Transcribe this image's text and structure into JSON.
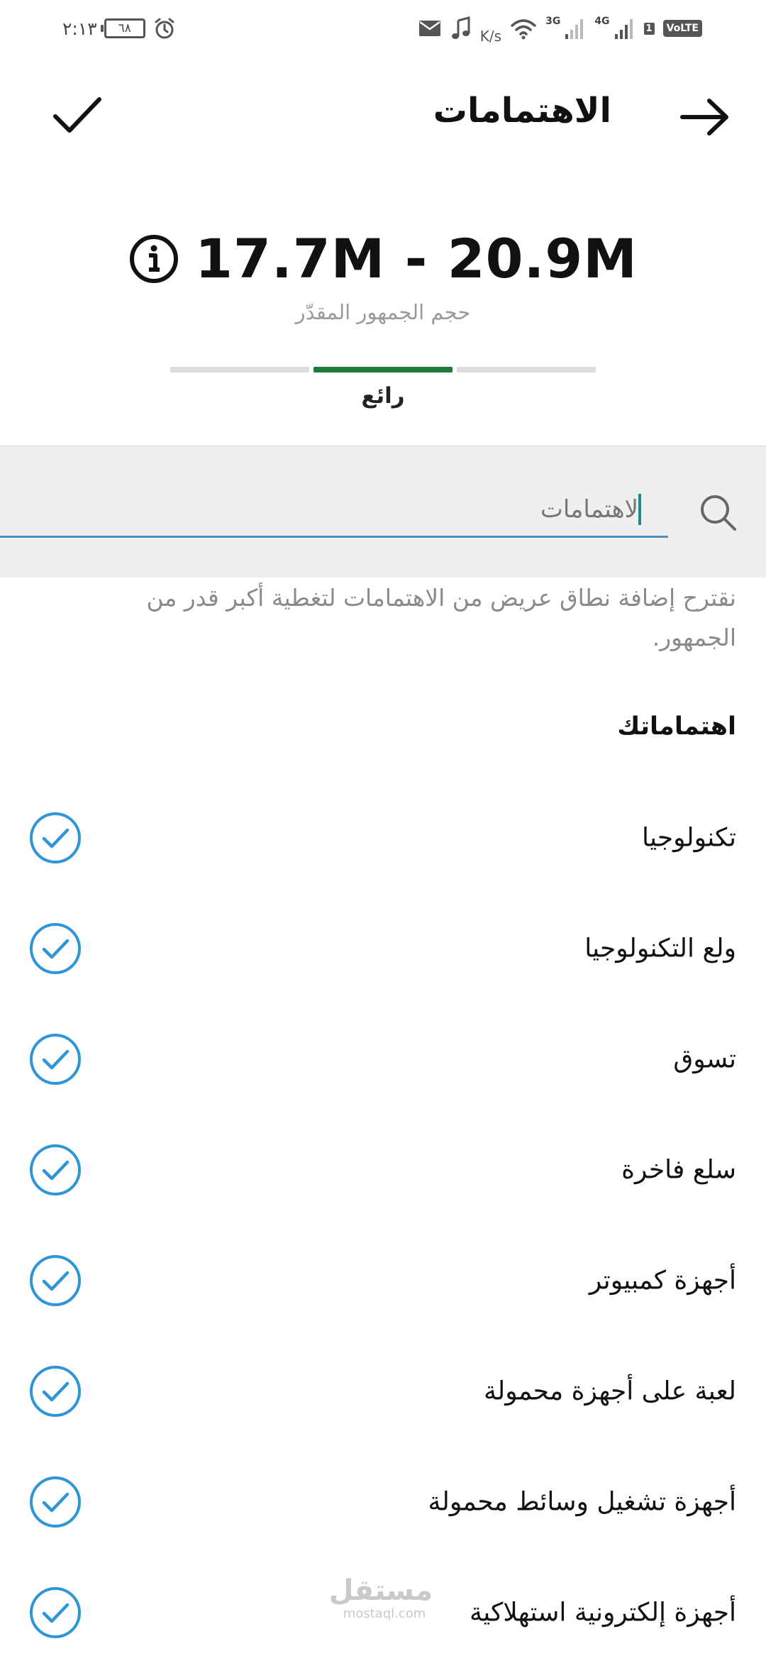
{
  "status_bar": {
    "time": "٢:١٣",
    "battery": "٦٨",
    "speed": "K/s",
    "net_3g": "3G",
    "net_4g": "4G",
    "sim": "1",
    "volte": "VoLTE"
  },
  "header": {
    "title": "الاهتمامات"
  },
  "audience": {
    "range": "17.7M - 20.9M",
    "caption": "حجم الجمهور المقدّر",
    "meter_label": "رائع",
    "meter_level": 2,
    "meter_segments": 3
  },
  "search": {
    "value": "لاهتمامات"
  },
  "suggestion": "نقترح إضافة نطاق عريض من الاهتمامات لتغطية أكبر قدر من الجمهور.",
  "interests": {
    "title": "اهتماماتك",
    "items": [
      "تكنولوجيا",
      "ولع التكنولوجيا",
      "تسوق",
      "سلع فاخرة",
      "أجهزة كمبيوتر",
      "لعبة على أجهزة محمولة",
      "أجهزة تشغيل وسائط محمولة",
      "أجهزة إلكترونية استهلاكية"
    ]
  },
  "watermark": {
    "arabic": "مستقل",
    "latin": "mostaql.com"
  },
  "colors": {
    "accent_blue": "#2f95d6",
    "meter_active": "#1f7a3a",
    "search_underline": "#4a90c2"
  }
}
